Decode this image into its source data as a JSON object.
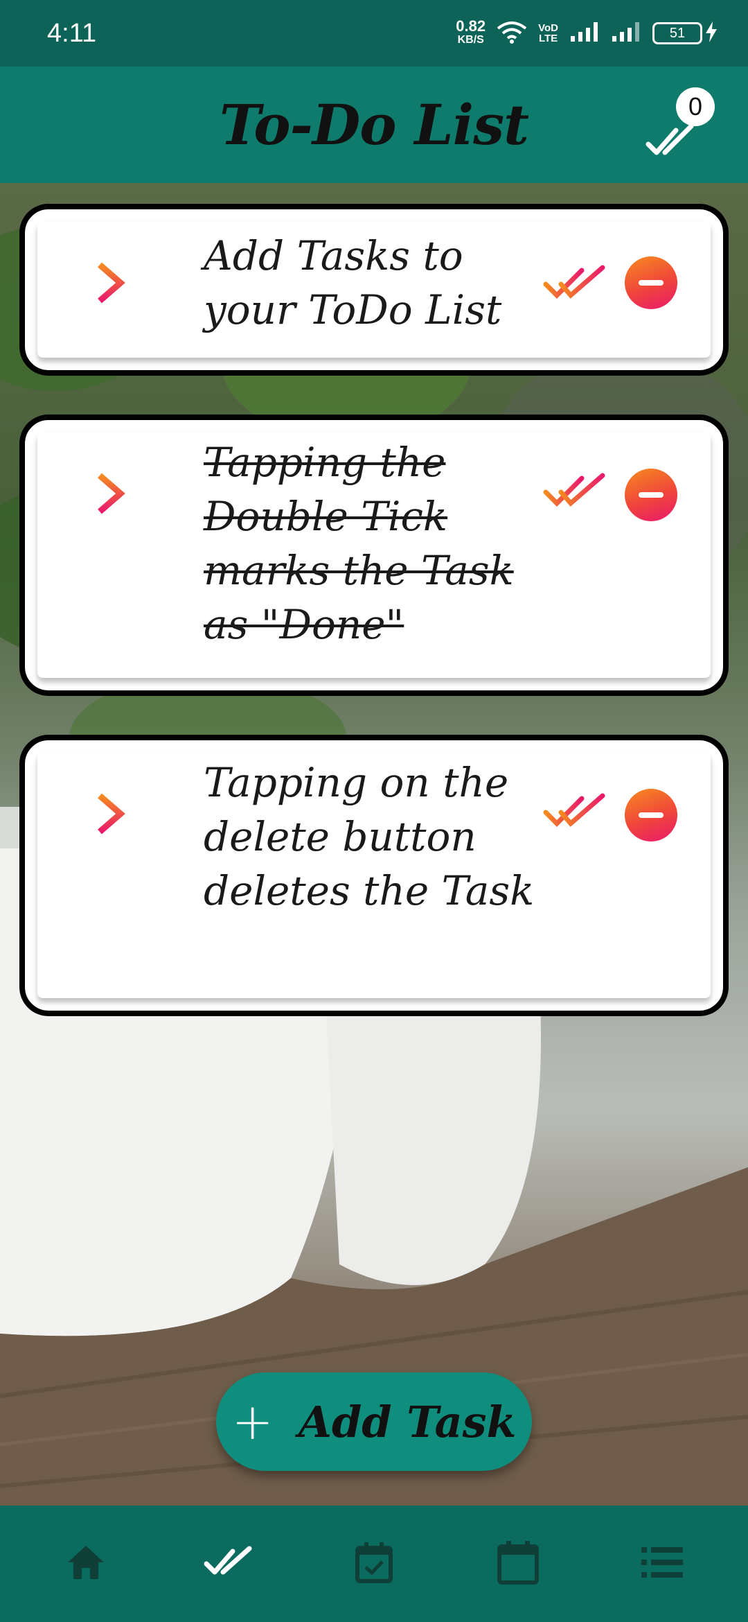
{
  "status_bar": {
    "time": "4:11",
    "net_speed_value": "0.82",
    "net_speed_unit": "KB/S",
    "volte_label_top": "VoD",
    "volte_label_bottom": "LTE",
    "battery_level": "51"
  },
  "app_bar": {
    "title": "To-Do List",
    "done_count": "0",
    "done_icon": "double-check-icon"
  },
  "tasks": [
    {
      "text": "Add Tasks to your ToDo List",
      "done": false
    },
    {
      "text": "Tapping the Double Tick marks the Task as \"Done\"",
      "done": true
    },
    {
      "text": "Tapping on the delete button deletes the Task",
      "done": false
    }
  ],
  "fab": {
    "icon": "plus-icon",
    "label": "Add Task"
  },
  "bottom_nav": {
    "items": [
      {
        "icon": "home-icon"
      },
      {
        "icon": "double-check-icon"
      },
      {
        "icon": "calendar-check-icon"
      },
      {
        "icon": "calendar-icon"
      },
      {
        "icon": "list-icon"
      }
    ]
  },
  "colors": {
    "status_bar": "#0d6358",
    "app_bar": "#0f7b6c",
    "fab": "#0f8e7e",
    "bottom_nav": "#0a6b5e",
    "accent_orange": "#f68b1f",
    "accent_pink": "#e9196c"
  }
}
